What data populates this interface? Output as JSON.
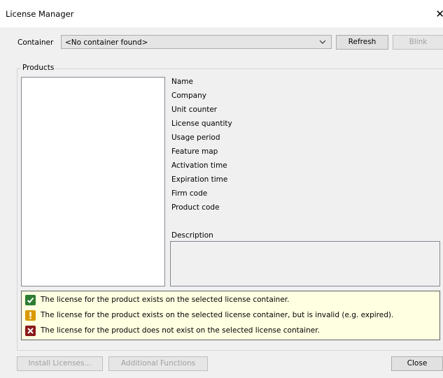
{
  "window": {
    "title": "License Manager"
  },
  "container": {
    "label": "Container",
    "selected": "<No container found>",
    "refresh_label": "Refresh",
    "blink_label": "Blink"
  },
  "products": {
    "group_title": "Products",
    "fields": [
      "Name",
      "Company",
      "Unit counter",
      "License quantity",
      "Usage period",
      "Feature map",
      "Activation time",
      "Expiration time",
      "Firm code",
      "Product code"
    ],
    "description_label": "Description"
  },
  "legend": {
    "items": [
      {
        "icon": "check-icon",
        "color": "#2e7d32",
        "text": "The license for the product exists on the selected license container."
      },
      {
        "icon": "warning-icon",
        "color": "#d99a00",
        "text": "The license for the product exists on the selected license container, but is invalid (e.g. expired)."
      },
      {
        "icon": "error-icon",
        "color": "#8b1a1a",
        "text": "The license for the product does not exist on the selected license container."
      }
    ]
  },
  "footer": {
    "install_label": "Install Licenses...",
    "additional_label": "Additional Functions",
    "close_label": "Close"
  }
}
